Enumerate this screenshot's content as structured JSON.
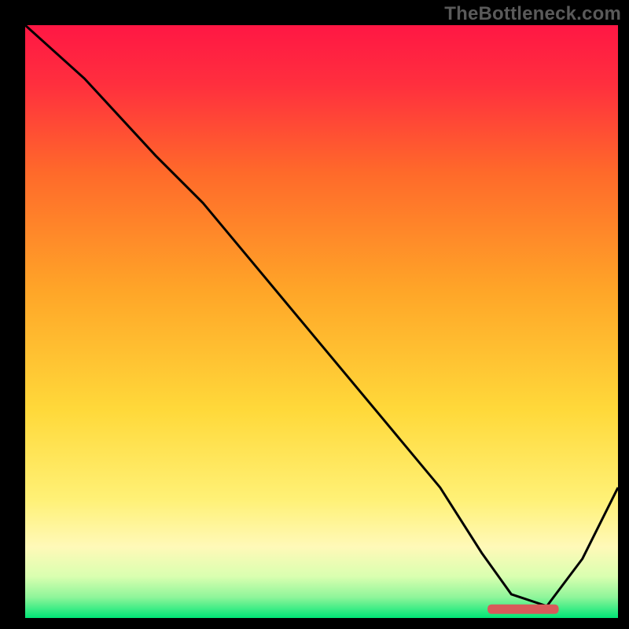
{
  "watermark": "TheBottleneck.com",
  "colors": {
    "background": "#000000",
    "watermark_text": "#5a5a5a",
    "curve_stroke": "#000000",
    "marker_fill": "#d85a5a",
    "gradient_stops": [
      {
        "offset": 0.0,
        "color": "#ff1744"
      },
      {
        "offset": 0.1,
        "color": "#ff2f3e"
      },
      {
        "offset": 0.25,
        "color": "#ff6a2a"
      },
      {
        "offset": 0.45,
        "color": "#ffa628"
      },
      {
        "offset": 0.65,
        "color": "#ffd93a"
      },
      {
        "offset": 0.8,
        "color": "#fff176"
      },
      {
        "offset": 0.88,
        "color": "#fff9b8"
      },
      {
        "offset": 0.93,
        "color": "#d9ffb0"
      },
      {
        "offset": 0.965,
        "color": "#8ff59a"
      },
      {
        "offset": 1.0,
        "color": "#00e676"
      }
    ]
  },
  "chart_data": {
    "type": "line",
    "title": "",
    "xlabel": "",
    "ylabel": "",
    "xlim": [
      0,
      100
    ],
    "ylim": [
      0,
      100
    ],
    "grid": false,
    "legend": null,
    "series": [
      {
        "name": "bottleneck-curve",
        "x": [
          0,
          10,
          22,
          30,
          40,
          50,
          60,
          70,
          77,
          82,
          88,
          94,
          100
        ],
        "y": [
          100,
          91,
          78,
          70,
          58,
          46,
          34,
          22,
          11,
          4,
          2,
          10,
          22
        ]
      }
    ],
    "annotations": [
      {
        "name": "optimum-marker",
        "shape": "bar",
        "x_start": 78,
        "x_end": 90,
        "y": 1.5,
        "thickness": 1.6
      }
    ]
  }
}
